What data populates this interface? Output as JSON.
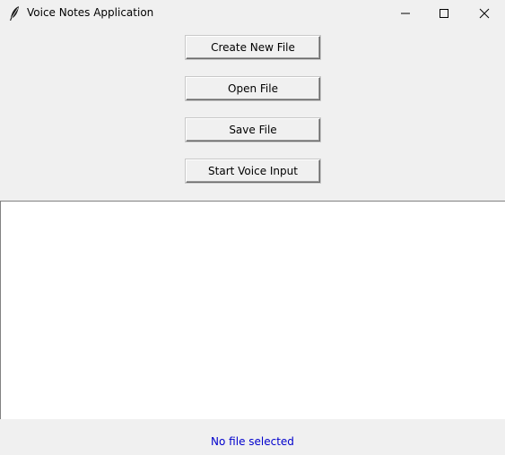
{
  "window": {
    "title": "Voice Notes Application",
    "icon": "feather-icon"
  },
  "buttons": {
    "create_label": "Create New File",
    "open_label": "Open File",
    "save_label": "Save File",
    "voice_label": "Start Voice Input"
  },
  "editor": {
    "content": ""
  },
  "status": {
    "text": "No file selected",
    "color": "#0000cc"
  }
}
